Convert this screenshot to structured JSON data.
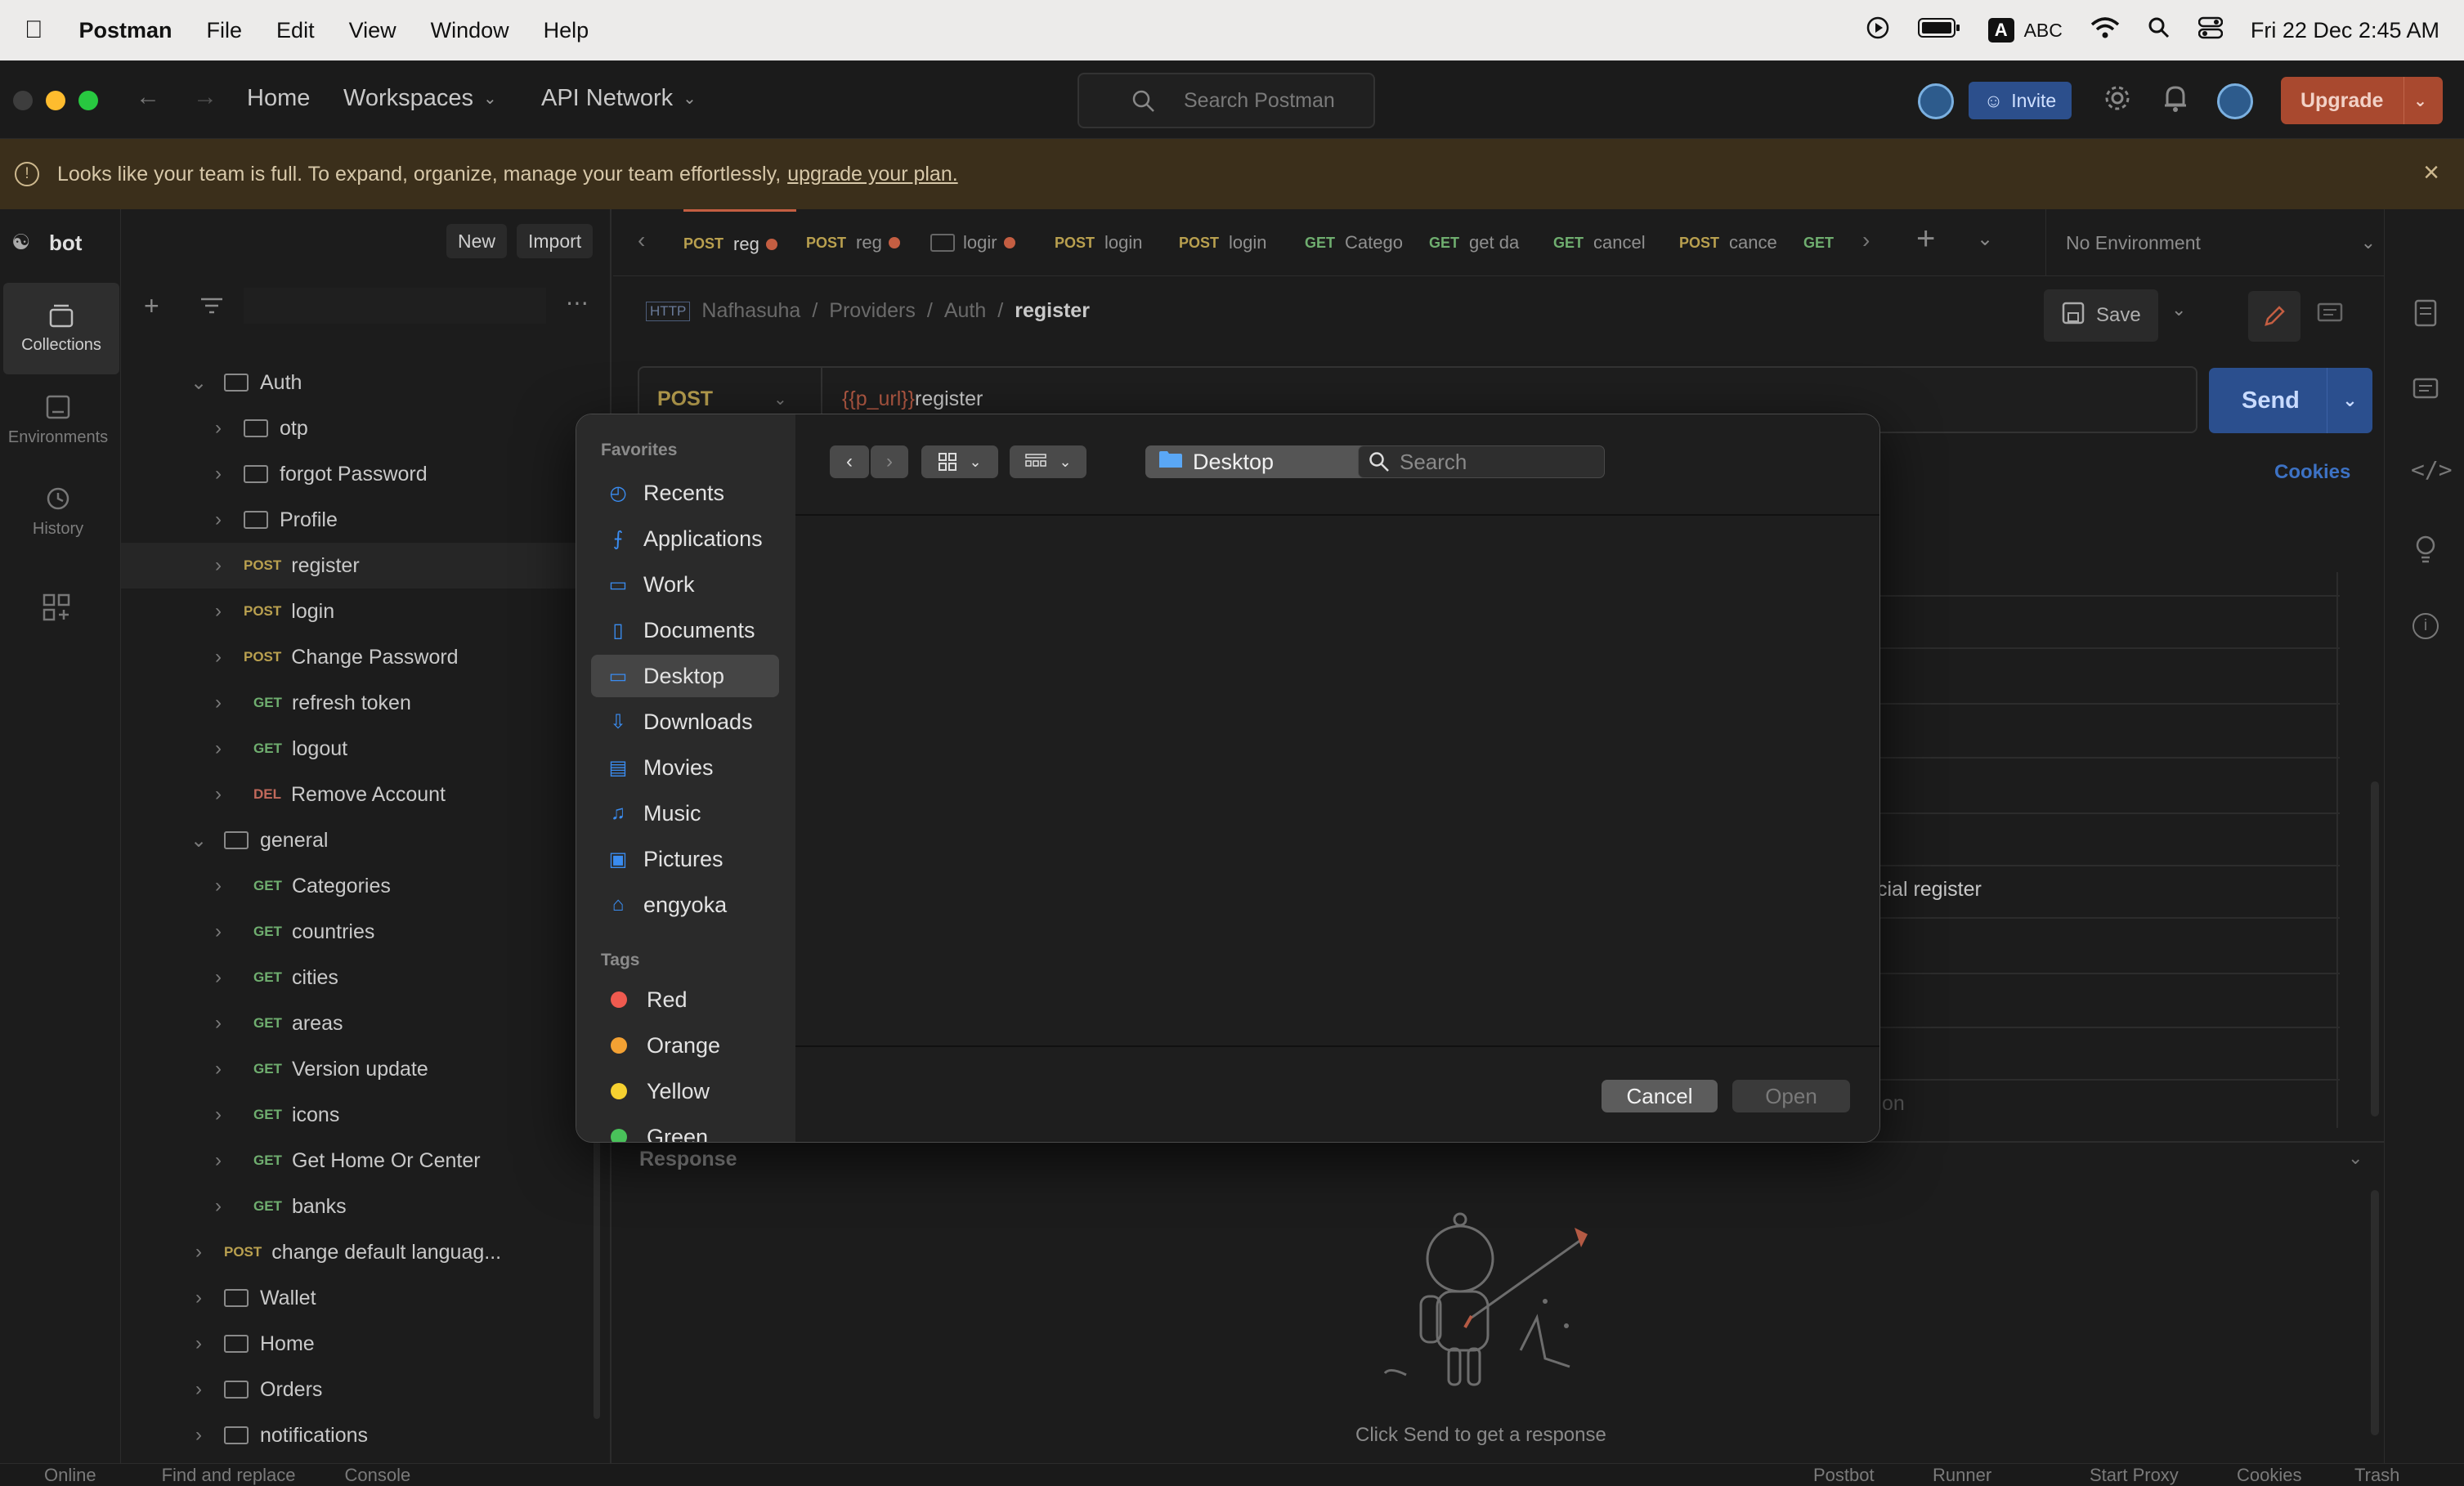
{
  "menubar": {
    "app": "Postman",
    "items": [
      "File",
      "Edit",
      "View",
      "Window",
      "Help"
    ],
    "input_mode": "ABC",
    "input_badge": "A",
    "datetime": "Fri 22 Dec  2:45 AM"
  },
  "titlebar": {
    "home": "Home",
    "workspaces": "Workspaces",
    "api_network": "API Network",
    "search_placeholder": "Search Postman",
    "invite": "Invite",
    "upgrade": "Upgrade"
  },
  "banner": {
    "text": "Looks like your team is full. To expand, organize, manage your team effortlessly,",
    "link": "upgrade your plan."
  },
  "leftnav": {
    "items": [
      {
        "label": "Collections"
      },
      {
        "label": "Environments"
      },
      {
        "label": "History"
      }
    ]
  },
  "sidebar": {
    "workspace": "bot",
    "new": "New",
    "import": "Import",
    "tree": [
      {
        "type": "folder",
        "label": "Auth",
        "level": 1,
        "open": true
      },
      {
        "type": "folder",
        "label": "otp",
        "level": 2
      },
      {
        "type": "folder",
        "label": "forgot Password",
        "level": 2
      },
      {
        "type": "folder",
        "label": "Profile",
        "level": 2
      },
      {
        "type": "request",
        "method": "POST",
        "label": "register",
        "level": 2,
        "selected": true
      },
      {
        "type": "request",
        "method": "POST",
        "label": "login",
        "level": 2
      },
      {
        "type": "request",
        "method": "POST",
        "label": "Change Password",
        "level": 2
      },
      {
        "type": "request",
        "method": "GET",
        "label": "refresh token",
        "level": 2
      },
      {
        "type": "request",
        "method": "GET",
        "label": "logout",
        "level": 2
      },
      {
        "type": "request",
        "method": "DEL",
        "label": "Remove Account",
        "level": 2
      },
      {
        "type": "folder",
        "label": "general",
        "level": 1,
        "open": true
      },
      {
        "type": "request",
        "method": "GET",
        "label": "Categories",
        "level": 2
      },
      {
        "type": "request",
        "method": "GET",
        "label": "countries",
        "level": 2
      },
      {
        "type": "request",
        "method": "GET",
        "label": "cities",
        "level": 2
      },
      {
        "type": "request",
        "method": "GET",
        "label": "areas",
        "level": 2
      },
      {
        "type": "request",
        "method": "GET",
        "label": "Version update",
        "level": 2
      },
      {
        "type": "request",
        "method": "GET",
        "label": "icons",
        "level": 2
      },
      {
        "type": "request",
        "method": "GET",
        "label": "Get Home Or Center",
        "level": 2
      },
      {
        "type": "request",
        "method": "GET",
        "label": "banks",
        "level": 2
      },
      {
        "type": "request",
        "method": "POST",
        "label": "change default languag...",
        "level": 1
      },
      {
        "type": "folder",
        "label": "Wallet",
        "level": 1
      },
      {
        "type": "folder",
        "label": "Home",
        "level": 1
      },
      {
        "type": "folder",
        "label": "Orders",
        "level": 1
      },
      {
        "type": "folder",
        "label": "notifications",
        "level": 1
      }
    ]
  },
  "tabs": [
    {
      "method": "POST",
      "label": "reg",
      "dot": true
    },
    {
      "method": "POST",
      "label": "reg",
      "dot": true
    },
    {
      "method": "",
      "label": "logir",
      "dot": true
    },
    {
      "method": "POST",
      "label": "login",
      "dot": false
    },
    {
      "method": "POST",
      "label": "login",
      "dot": false
    },
    {
      "method": "GET",
      "label": "Catego",
      "dot": false
    },
    {
      "method": "GET",
      "label": "get da",
      "dot": false
    },
    {
      "method": "GET",
      "label": "cancel",
      "dot": false
    },
    {
      "method": "POST",
      "label": "cance",
      "dot": false
    },
    {
      "method": "GET",
      "label": "",
      "dot": false
    }
  ],
  "environment": "No Environment",
  "request": {
    "breadcrumb": [
      "Nafhasuha",
      "Providers",
      "Auth"
    ],
    "current": "register",
    "save": "Save",
    "method": "POST",
    "url_var": "{{p_url}}",
    "url_path": "register",
    "send": "Send",
    "cookies": "Cookies",
    "partial_row": "cial register",
    "partial_row2": "on",
    "response_label": "Response",
    "empty_response": "Click Send to get a response"
  },
  "dialog": {
    "favorites_heading": "Favorites",
    "favorites": [
      {
        "icon": "clock-icon",
        "label": "Recents"
      },
      {
        "icon": "applications-icon",
        "label": "Applications"
      },
      {
        "icon": "folder-icon",
        "label": "Work"
      },
      {
        "icon": "document-icon",
        "label": "Documents"
      },
      {
        "icon": "desktop-icon",
        "label": "Desktop",
        "selected": true
      },
      {
        "icon": "download-icon",
        "label": "Downloads"
      },
      {
        "icon": "film-icon",
        "label": "Movies"
      },
      {
        "icon": "music-icon",
        "label": "Music"
      },
      {
        "icon": "picture-icon",
        "label": "Pictures"
      },
      {
        "icon": "home-icon",
        "label": "engyoka"
      }
    ],
    "tags_heading": "Tags",
    "tags": [
      {
        "label": "Red",
        "color": "#ef5a4f"
      },
      {
        "label": "Orange",
        "color": "#f3a133"
      },
      {
        "label": "Yellow",
        "color": "#f6d130"
      },
      {
        "label": "Green",
        "color": "#49c25a"
      }
    ],
    "location": "Desktop",
    "search_placeholder": "Search",
    "cancel": "Cancel",
    "open": "Open"
  },
  "statusbar": {
    "left": [
      "Online",
      "Find and replace",
      "Console"
    ],
    "right": [
      "Postbot",
      "Runner",
      "Start Proxy",
      "Cookies",
      "Trash"
    ]
  },
  "colors": {
    "accent_blue": "#2f6fe0",
    "upgrade_orange": "#a9492f",
    "invite_blue": "#2c4f8c",
    "banner_bg": "#3b2f1b"
  }
}
